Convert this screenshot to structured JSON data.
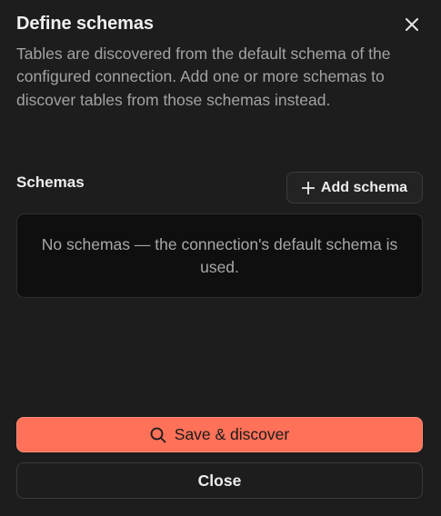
{
  "dialog": {
    "title": "Define schemas",
    "description": "Tables are discovered from the default schema of the configured connection. Add one or more schemas to discover tables from those schemas instead."
  },
  "schemas": {
    "label": "Schemas",
    "add_label": "Add schema",
    "empty_message": "No schemas — the connection's default schema is used."
  },
  "footer": {
    "primary_label": "Save & discover",
    "secondary_label": "Close"
  },
  "icons": {
    "close": "close-icon",
    "add": "plus-icon",
    "search": "search-icon"
  },
  "colors": {
    "background": "#1d1d1d",
    "accent": "#ff7159",
    "empty_panel": "#0f0f0f"
  }
}
